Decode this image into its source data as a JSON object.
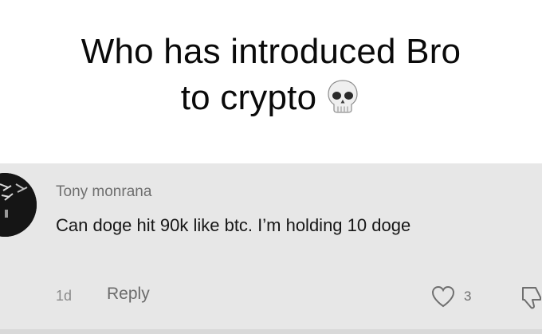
{
  "caption": {
    "line1": "Who has introduced Bro",
    "line2": "to crypto",
    "emoji_icon": "skull-emoji"
  },
  "comment": {
    "username": "Tony monrana",
    "text": "Can doge hit 90k like btc. I’m holding 10 doge",
    "time": "1d",
    "reply_label": "Reply",
    "like_count": "3",
    "avatar_icon": "avatar-image",
    "like_icon": "heart-outline-icon",
    "dislike_icon": "thumbs-down-outline-icon"
  },
  "colors": {
    "caption_background": "#ffffff",
    "comment_background": "#e7e7e7",
    "username_text": "#6f6f6f",
    "comment_text": "#161616"
  }
}
